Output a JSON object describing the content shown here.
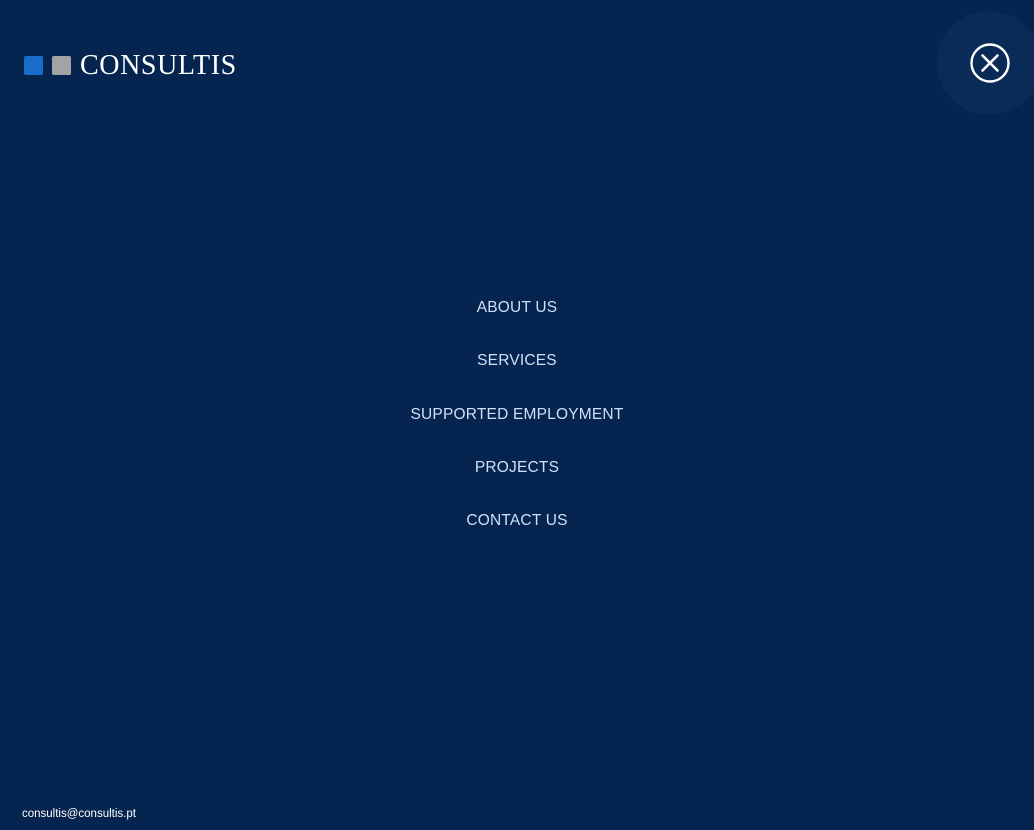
{
  "brand": {
    "name": "CONSULTIS",
    "colors": {
      "background": "#05244f",
      "square_blue": "#1a6cc9",
      "square_gray": "#a3a3a3",
      "menu_text": "#cfe0f6"
    }
  },
  "close_button": {
    "icon": "close-circle-icon"
  },
  "menu": {
    "items": [
      {
        "label": "ABOUT US"
      },
      {
        "label": "SERVICES"
      },
      {
        "label": "SUPPORTED EMPLOYMENT"
      },
      {
        "label": "PROJECTS"
      },
      {
        "label": "CONTACT US"
      }
    ]
  },
  "footer": {
    "email": "consultis@consultis.pt"
  }
}
